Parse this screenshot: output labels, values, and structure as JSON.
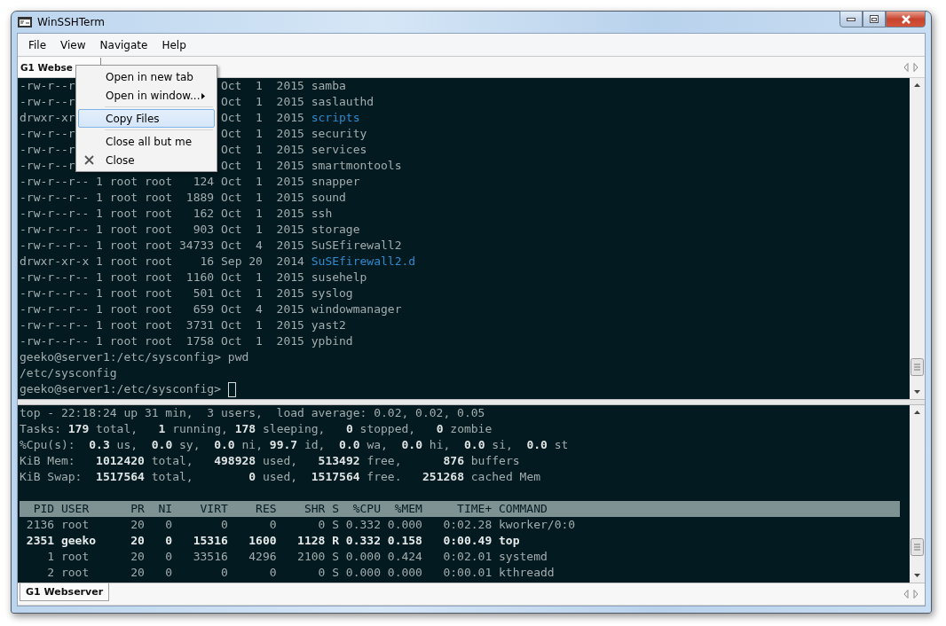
{
  "window": {
    "title": "WinSSHTerm"
  },
  "menu_bar": [
    "File",
    "View",
    "Navigate",
    "Help"
  ],
  "top_tabs": [
    {
      "label": "G1 Webse",
      "selected": true
    }
  ],
  "terminal": {
    "lines": [
      {
        "lead": "-rw-r--r",
        "rest": "Oct  1  2015 ",
        "name": "samba",
        "kind": "file"
      },
      {
        "lead": "-rw-r--r",
        "rest": "Oct  1  2015 ",
        "name": "saslauthd",
        "kind": "file"
      },
      {
        "lead": "drwxr-xr",
        "rest": "Oct  1  2015 ",
        "name": "scripts",
        "kind": "dir"
      },
      {
        "lead": "-rw-r--r",
        "rest": "Oct  1  2015 ",
        "name": "security",
        "kind": "file"
      },
      {
        "lead": "-rw-r--r",
        "rest": "Oct  1  2015 ",
        "name": "services",
        "kind": "file"
      },
      {
        "lead": "-rw-r--r",
        "rest": "Oct  1  2015 ",
        "name": "smartmontools",
        "kind": "file"
      },
      {
        "rest": "-rw-r--r-- 1 root root   124 Oct  1  2015 ",
        "name": "snapper",
        "kind": "file"
      },
      {
        "rest": "-rw-r--r-- 1 root root  1889 Oct  1  2015 ",
        "name": "sound",
        "kind": "file"
      },
      {
        "rest": "-rw-r--r-- 1 root root   162 Oct  1  2015 ",
        "name": "ssh",
        "kind": "file"
      },
      {
        "rest": "-rw-r--r-- 1 root root   903 Oct  1  2015 ",
        "name": "storage",
        "kind": "file"
      },
      {
        "rest": "-rw-r--r-- 1 root root 34733 Oct  4  2015 ",
        "name": "SuSEfirewall2",
        "kind": "file"
      },
      {
        "rest": "drwxr-xr-x 1 root root    16 Sep 20  2014 ",
        "name": "SuSEfirewall2.d",
        "kind": "dir"
      },
      {
        "rest": "-rw-r--r-- 1 root root  1160 Oct  1  2015 ",
        "name": "susehelp",
        "kind": "file"
      },
      {
        "rest": "-rw-r--r-- 1 root root   501 Oct  1  2015 ",
        "name": "syslog",
        "kind": "file"
      },
      {
        "rest": "-rw-r--r-- 1 root root   659 Oct  4  2015 ",
        "name": "windowmanager",
        "kind": "file"
      },
      {
        "rest": "-rw-r--r-- 1 root root  3731 Oct  1  2015 ",
        "name": "yast2",
        "kind": "file"
      },
      {
        "rest": "-rw-r--r-- 1 root root  1758 Oct  1  2015 ",
        "name": "ypbind",
        "kind": "file"
      },
      {
        "rest": "geeko@server1:/etc/sysconfig> pwd",
        "cursor": false
      },
      {
        "rest": "/etc/sysconfig",
        "cursor": false
      },
      {
        "rest": "geeko@server1:/etc/sysconfig> ",
        "cursor": true
      }
    ]
  },
  "context_menu": {
    "items": [
      {
        "kind": "item",
        "label": "Open in new tab",
        "selected": false,
        "submenu": false,
        "icon": false
      },
      {
        "kind": "item",
        "label": "Open in window...",
        "selected": false,
        "submenu": true,
        "icon": false
      },
      {
        "kind": "separator"
      },
      {
        "kind": "item",
        "label": "Copy Files",
        "selected": true,
        "submenu": false,
        "icon": false
      },
      {
        "kind": "separator"
      },
      {
        "kind": "item",
        "label": "Close all but me",
        "selected": false,
        "submenu": false,
        "icon": false
      },
      {
        "kind": "item",
        "label": "Close",
        "selected": false,
        "submenu": false,
        "icon": true
      }
    ]
  },
  "top_monitor": {
    "summary": [
      "top - 22:18:24 up 31 min,  3 users,  load average: 0.02, 0.02, 0.05",
      "Tasks: **179** total,   **1** running, **178** sleeping,   **0** stopped,   **0** zombie",
      "%Cpu(s):  **0.3** us,  **0.0** sy,  **0.0** ni, **99.7** id,  **0.0** wa,  **0.0** hi,  **0.0** si,  **0.0** st",
      "KiB Mem:   **1012420** total,   **498928** used,   **513492** free,      **876** buffers",
      "KiB Swap:  **1517564** total,        **0** used,  **1517564** free.   **251268** cached Mem"
    ],
    "header": "  PID USER      PR  NI    VIRT    RES    SHR S  %CPU  %MEM     TIME+ COMMAND",
    "processes": [
      {
        "text": " 2136 root      20   0       0      0      0 S 0.332 0.000   0:02.28 kworker/0:0",
        "bold": false
      },
      {
        "text": " 2351 geeko     20   0   15316   1600   1128 R 0.332 0.158   0:00.49 top",
        "bold": true
      },
      {
        "text": "    1 root      20   0   33516   4296   2100 S 0.000 0.424   0:02.01 systemd",
        "bold": false
      },
      {
        "text": "    2 root      20   0       0      0      0 S 0.000 0.000   0:00.01 kthreadd",
        "bold": false
      }
    ]
  },
  "bottom_tabs": [
    {
      "label": "G1 Webserver",
      "selected": true
    }
  ]
}
